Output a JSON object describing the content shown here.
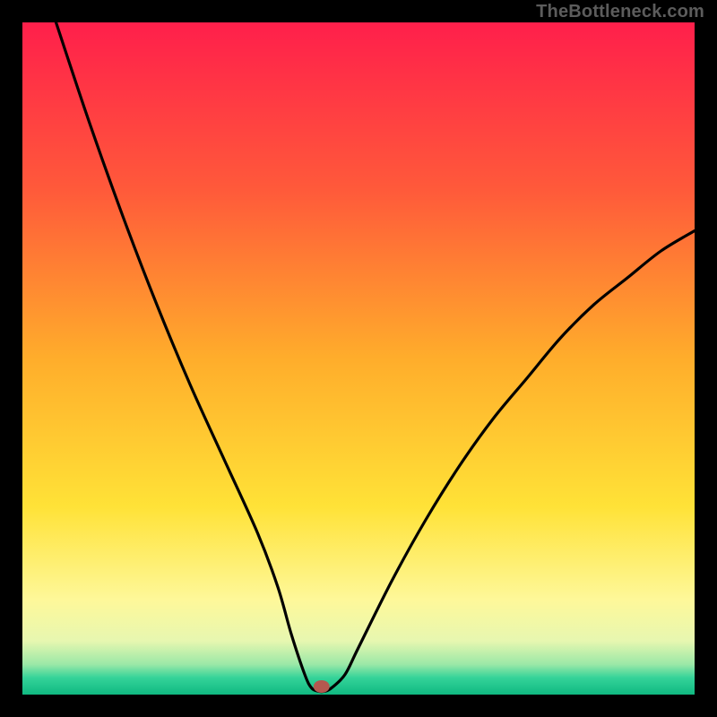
{
  "watermark": "TheBottleneck.com",
  "chart_data": {
    "type": "line",
    "title": "",
    "xlabel": "",
    "ylabel": "",
    "xlim": [
      0,
      100
    ],
    "ylim": [
      0,
      100
    ],
    "background_gradient_stops": [
      {
        "offset": 0.0,
        "color": "#ff1f4b"
      },
      {
        "offset": 0.25,
        "color": "#ff5a3a"
      },
      {
        "offset": 0.5,
        "color": "#ffad2b"
      },
      {
        "offset": 0.72,
        "color": "#ffe237"
      },
      {
        "offset": 0.86,
        "color": "#fef89a"
      },
      {
        "offset": 0.92,
        "color": "#e7f7b0"
      },
      {
        "offset": 0.955,
        "color": "#9be8a7"
      },
      {
        "offset": 0.975,
        "color": "#34d399"
      },
      {
        "offset": 1.0,
        "color": "#10b981"
      }
    ],
    "series": [
      {
        "name": "bottleneck-curve",
        "x": [
          5,
          10,
          15,
          20,
          25,
          30,
          35,
          38,
          40,
          42,
          43,
          44,
          45,
          46,
          48,
          50,
          55,
          60,
          65,
          70,
          75,
          80,
          85,
          90,
          95,
          100
        ],
        "y": [
          100,
          85,
          71,
          58,
          46,
          35,
          24,
          16,
          9,
          3,
          1,
          0.5,
          0.5,
          1,
          3,
          7,
          17,
          26,
          34,
          41,
          47,
          53,
          58,
          62,
          66,
          69
        ]
      }
    ],
    "marker": {
      "x": 44.5,
      "y": 1.2,
      "color": "#b5584f"
    }
  }
}
